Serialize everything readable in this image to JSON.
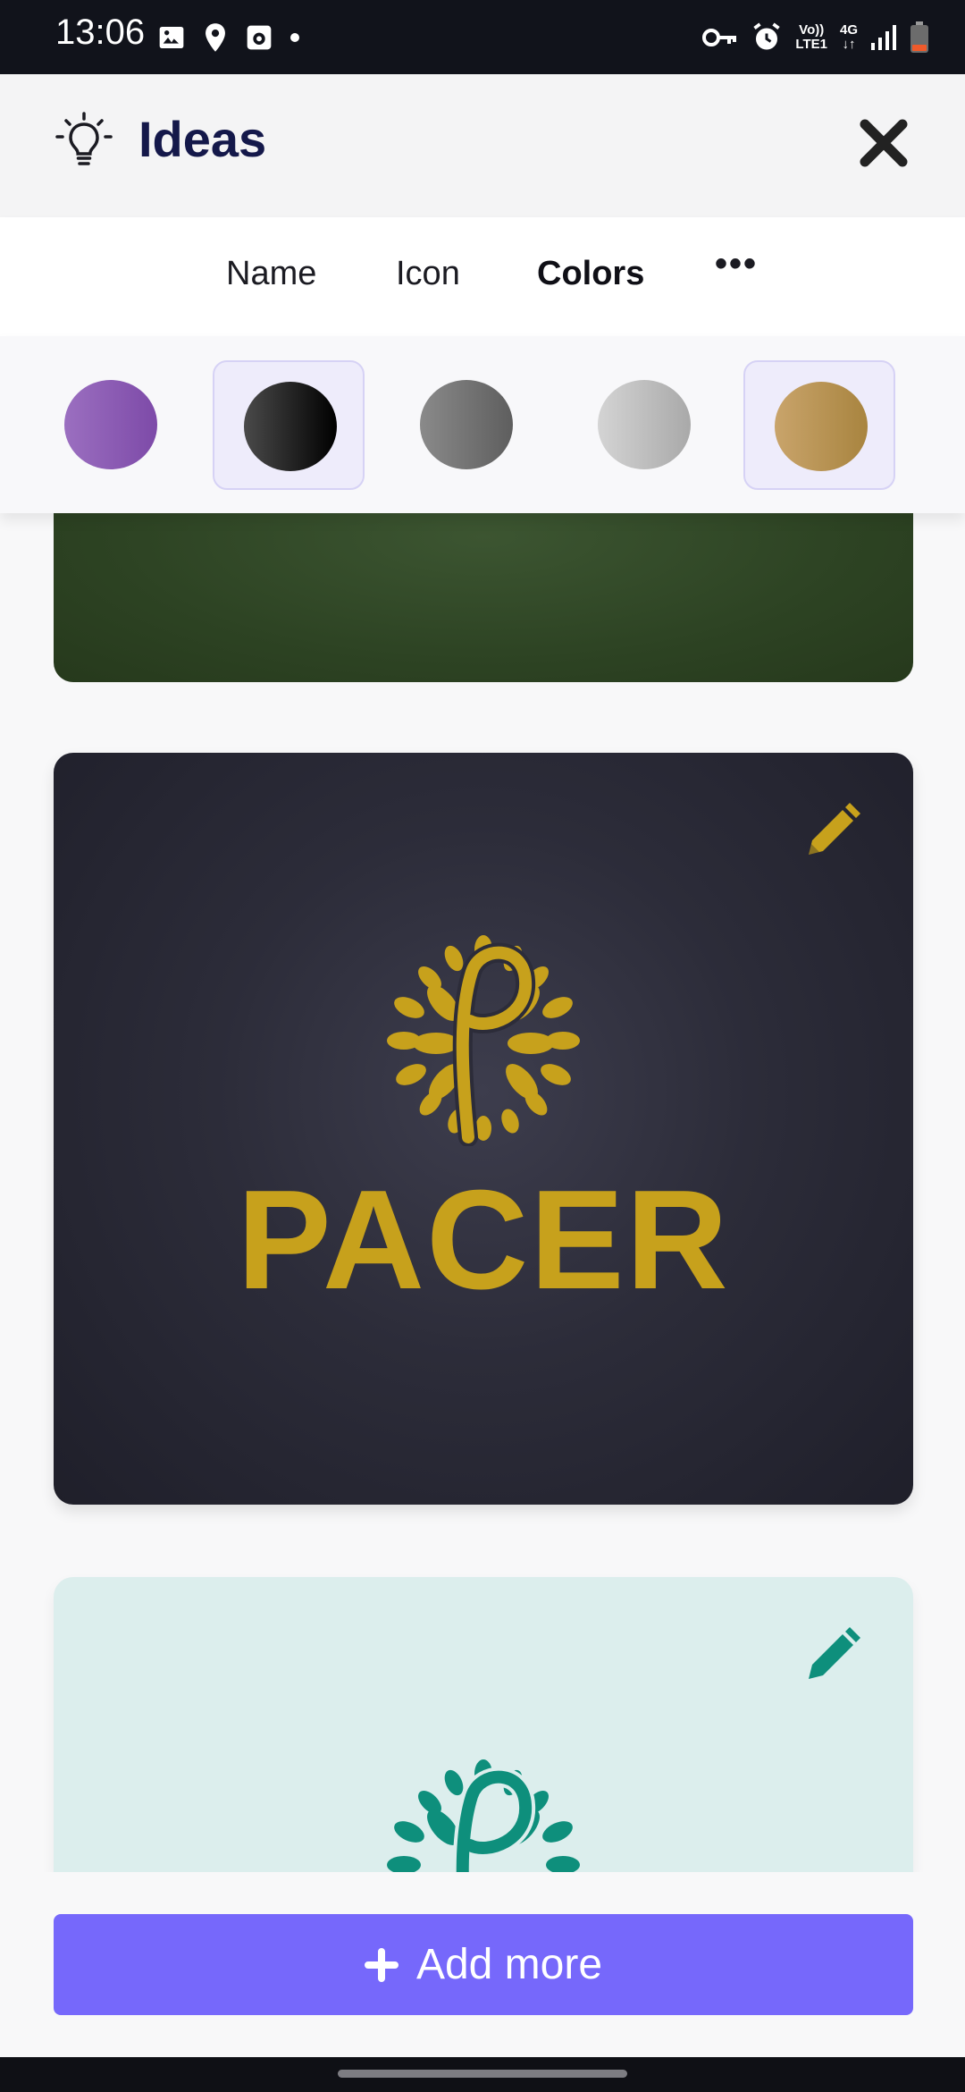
{
  "status_bar": {
    "time": "13:06",
    "network_top": "Vo))",
    "network_bottom": "LTE1",
    "data_top": "4G",
    "data_bottom": "↓↑",
    "left_icons": [
      "image-icon",
      "location-icon",
      "screen-record-icon",
      "dot-icon"
    ],
    "right_icons": [
      "vpn-key-icon",
      "alarm-icon",
      "volte-icon",
      "4g-icon",
      "signal-icon",
      "battery-icon"
    ]
  },
  "header": {
    "title": "Ideas",
    "icon": "lightbulb-icon",
    "close_icon": "close-icon"
  },
  "tabs": [
    {
      "label": "Name",
      "active": false
    },
    {
      "label": "Icon",
      "active": false
    },
    {
      "label": "Colors",
      "active": true
    },
    {
      "label": "•••",
      "active": false
    }
  ],
  "swatches": [
    {
      "name": "purple",
      "from": "#9b6fc0",
      "to": "#7d4aa8",
      "selected": false
    },
    {
      "name": "black",
      "from": "#4a4a4a",
      "to": "#000000",
      "selected": true
    },
    {
      "name": "dark-gray",
      "from": "#8a8a8a",
      "to": "#5e5e5e",
      "selected": false
    },
    {
      "name": "light-gray",
      "from": "#d4d4d4",
      "to": "#a9a9a9",
      "selected": false
    },
    {
      "name": "gold",
      "from": "#c9a46b",
      "to": "#a8843f",
      "selected": true
    }
  ],
  "cards": [
    {
      "background": "green",
      "partial": true
    },
    {
      "brand_text": "PACER",
      "logo_color": "#c7a11c",
      "edit_icon": "pencil-icon"
    },
    {
      "logo_color": "#0e8f7c",
      "edit_icon": "pencil-icon",
      "partial": true
    }
  ],
  "bottom": {
    "add_button_label": "Add more",
    "accent": "#7668fb"
  }
}
